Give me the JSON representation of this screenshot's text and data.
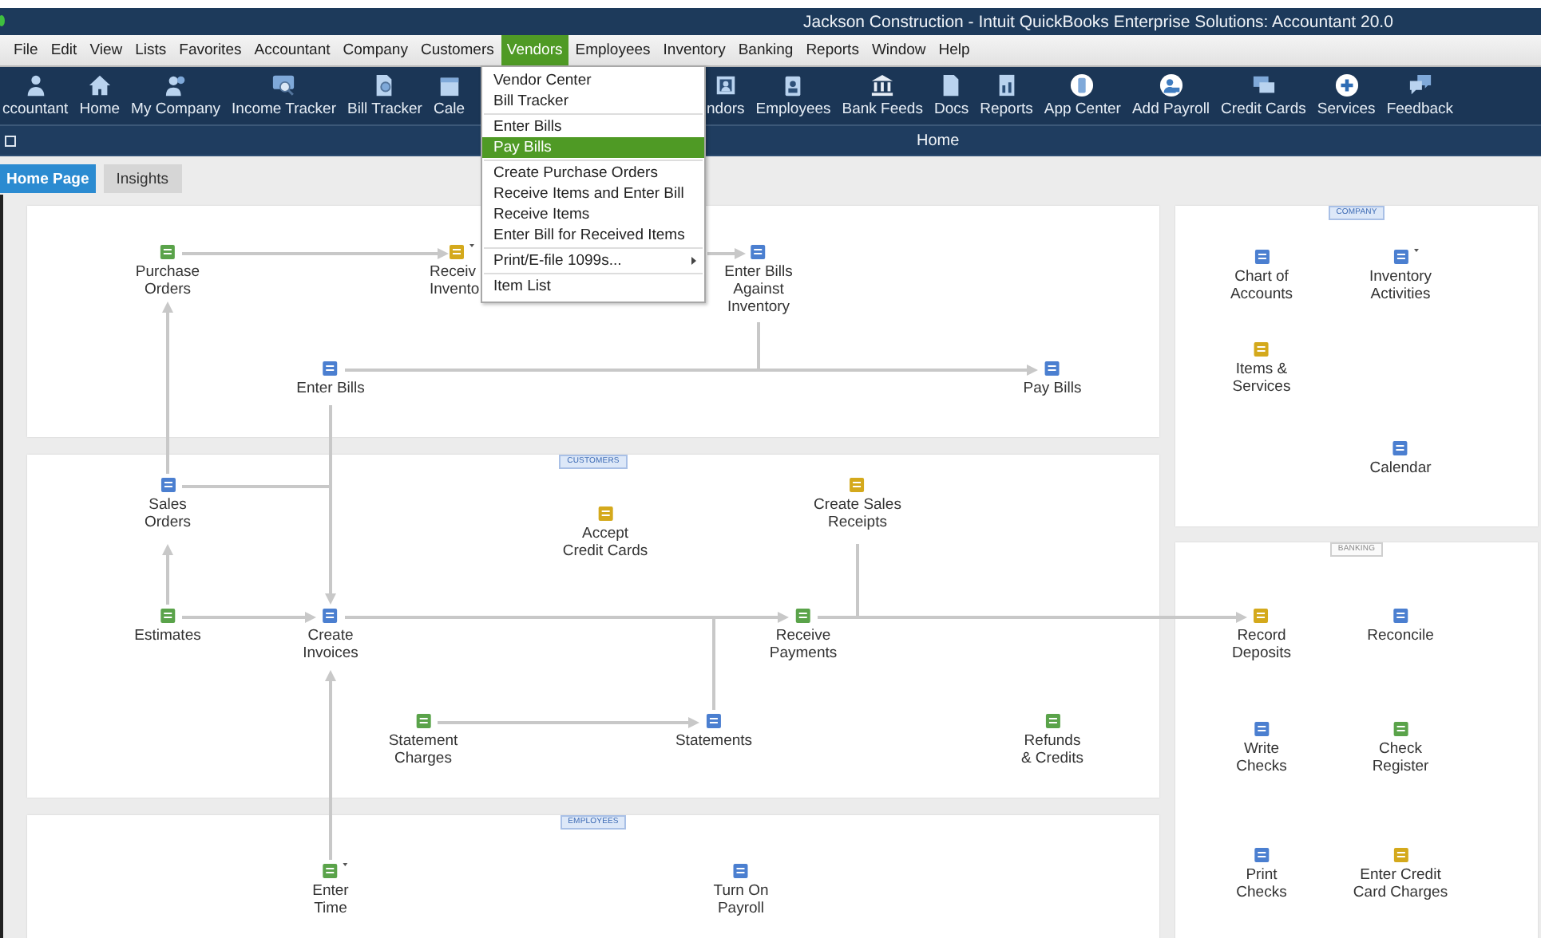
{
  "window": {
    "title": "Jackson Construction  - Intuit QuickBooks Enterprise Solutions: Accountant 20.0"
  },
  "menu_bar": [
    {
      "label": "File",
      "selected": false
    },
    {
      "label": "Edit",
      "selected": false
    },
    {
      "label": "View",
      "selected": false
    },
    {
      "label": "Lists",
      "selected": false
    },
    {
      "label": "Favorites",
      "selected": false
    },
    {
      "label": "Accountant",
      "selected": false
    },
    {
      "label": "Company",
      "selected": false
    },
    {
      "label": "Customers",
      "selected": false
    },
    {
      "label": "Vendors",
      "selected": true
    },
    {
      "label": "Employees",
      "selected": false
    },
    {
      "label": "Inventory",
      "selected": false
    },
    {
      "label": "Banking",
      "selected": false
    },
    {
      "label": "Reports",
      "selected": false
    },
    {
      "label": "Window",
      "selected": false
    },
    {
      "label": "Help",
      "selected": false
    }
  ],
  "toolbar_left": [
    "ccountant",
    "Home",
    "My Company",
    "Income Tracker",
    "Bill Tracker",
    "Cale"
  ],
  "toolbar_right": [
    "ndors",
    "Employees",
    "Bank Feeds",
    "Docs",
    "Reports",
    "App Center",
    "Add Payroll",
    "Credit Cards",
    "Services",
    "Feedback"
  ],
  "page_bar": {
    "title": "Home"
  },
  "tabs": [
    {
      "label": "Home Page",
      "selected": true
    },
    {
      "label": "Insights",
      "selected": false
    }
  ],
  "vendors_menu": {
    "groups": [
      [
        {
          "label": "Vendor Center",
          "selected": false,
          "submenu": false
        },
        {
          "label": "Bill Tracker",
          "selected": false,
          "submenu": false
        }
      ],
      [
        {
          "label": "Enter Bills",
          "selected": false,
          "submenu": false
        },
        {
          "label": "Pay Bills",
          "selected": true,
          "submenu": false
        }
      ],
      [
        {
          "label": "Create Purchase Orders",
          "selected": false,
          "submenu": false
        },
        {
          "label": "Receive Items and Enter Bill",
          "selected": false,
          "submenu": false
        },
        {
          "label": "Receive Items",
          "selected": false,
          "submenu": false
        },
        {
          "label": "Enter Bill for Received Items",
          "selected": false,
          "submenu": false
        }
      ],
      [
        {
          "label": "Print/E-file 1099s...",
          "selected": false,
          "submenu": true
        }
      ],
      [
        {
          "label": "Item List",
          "selected": false,
          "submenu": false
        }
      ]
    ]
  },
  "home_page": {
    "sections": [
      {
        "nodes": [
          {
            "label": "Purchase\nOrders",
            "has_menu": false
          },
          {
            "label": "Receiv\nInvento",
            "has_menu": true
          },
          {
            "label": "Enter Bills\nAgainst\nInventory",
            "has_menu": false
          },
          {
            "label": "Enter Bills",
            "has_menu": false
          },
          {
            "label": "Pay Bills",
            "has_menu": false
          }
        ]
      },
      {
        "label": "CUSTOMERS",
        "label_highlighted": true,
        "nodes": [
          {
            "label": "Sales\nOrders",
            "has_menu": false
          },
          {
            "label": "Accept\nCredit Cards",
            "has_menu": false
          },
          {
            "label": "Create Sales\nReceipts",
            "has_menu": false
          },
          {
            "label": "Estimates",
            "has_menu": false
          },
          {
            "label": "Create\nInvoices",
            "has_menu": false
          },
          {
            "label": "Receive\nPayments",
            "has_menu": false
          },
          {
            "label": "Statement\nCharges",
            "has_menu": false
          },
          {
            "label": "Statements",
            "has_menu": false
          },
          {
            "label": "Refunds\n& Credits",
            "has_menu": false
          }
        ]
      },
      {
        "label": "EMPLOYEES",
        "label_highlighted": true,
        "nodes": [
          {
            "label": "Enter\nTime",
            "has_menu": true
          },
          {
            "label": "Turn On\nPayroll",
            "has_menu": false
          }
        ]
      },
      {
        "label": "COMPANY",
        "label_highlighted": true,
        "nodes": [
          {
            "label": "Chart of\nAccounts",
            "has_menu": false
          },
          {
            "label": "Inventory\nActivities",
            "has_menu": true
          },
          {
            "label": "Items &\nServices",
            "has_menu": false
          },
          {
            "label": "Calendar",
            "has_menu": false
          }
        ]
      },
      {
        "label": "BANKING",
        "label_highlighted": false,
        "nodes": [
          {
            "label": "Record\nDeposits",
            "has_menu": false
          },
          {
            "label": "Reconcile",
            "has_menu": false
          },
          {
            "label": "Write\nChecks",
            "has_menu": false
          },
          {
            "label": "Check\nRegister",
            "has_menu": false
          },
          {
            "label": "Print\nChecks",
            "has_menu": false
          },
          {
            "label": "Enter Credit\nCard Charges",
            "has_menu": false
          }
        ]
      }
    ]
  }
}
